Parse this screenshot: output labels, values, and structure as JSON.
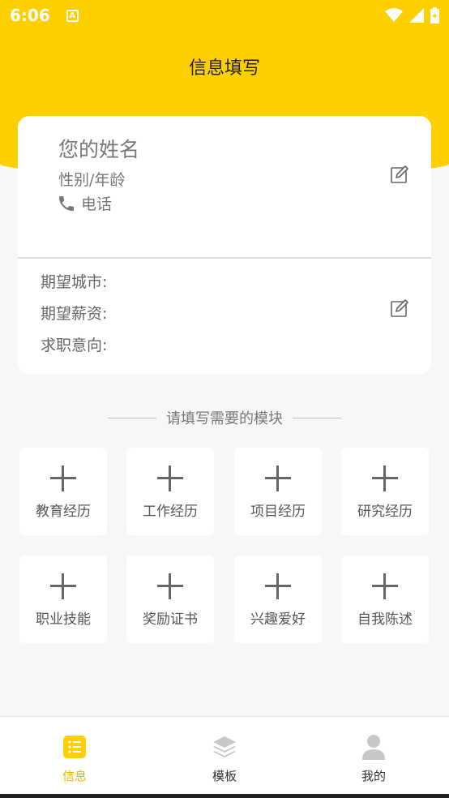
{
  "status_bar": {
    "time": "6:06",
    "a_badge": "A"
  },
  "header": {
    "title": "信息填写"
  },
  "profile": {
    "name_placeholder": "您的姓名",
    "gender_age": "性别/年龄",
    "phone_label": "电话"
  },
  "job": {
    "city_label": "期望城市:",
    "salary_label": "期望薪资:",
    "intent_label": "求职意向:"
  },
  "section": {
    "title": "请填写需要的模块"
  },
  "modules": [
    {
      "label": "教育经历"
    },
    {
      "label": "工作经历"
    },
    {
      "label": "项目经历"
    },
    {
      "label": "研究经历"
    },
    {
      "label": "职业技能"
    },
    {
      "label": "奖励证书"
    },
    {
      "label": "兴趣爱好"
    },
    {
      "label": "自我陈述"
    }
  ],
  "nav": [
    {
      "label": "信息",
      "icon": "list-icon",
      "active": true
    },
    {
      "label": "模板",
      "icon": "layers-icon",
      "active": false
    },
    {
      "label": "我的",
      "icon": "user-icon",
      "active": false
    }
  ],
  "colors": {
    "accent": "#ffd000",
    "active_nav": "#f2b500"
  }
}
